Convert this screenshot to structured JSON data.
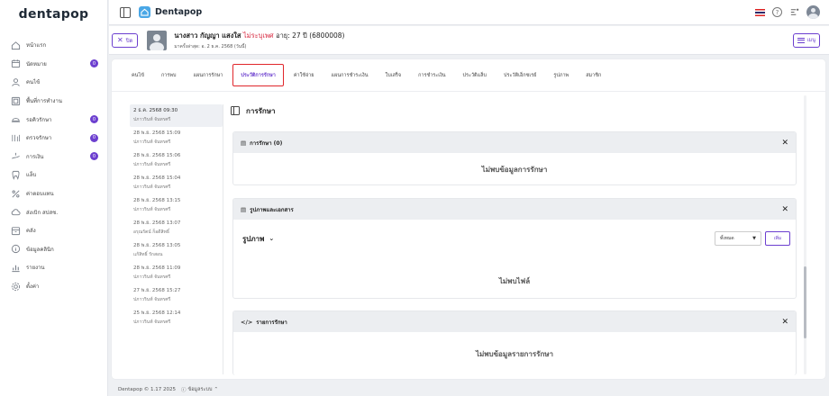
{
  "brand": {
    "logo_text": "dentapop"
  },
  "sidebar": {
    "items": [
      {
        "label": "หน้าแรก",
        "icon": "home-icon",
        "badge": ""
      },
      {
        "label": "นัดหมาย",
        "icon": "calendar-icon",
        "badge": "0"
      },
      {
        "label": "คนไข้",
        "icon": "user-icon",
        "badge": ""
      },
      {
        "label": "พื้นที่การทำงาน",
        "icon": "workspace-icon",
        "badge": ""
      },
      {
        "label": "รอคิวรักษา",
        "icon": "queue-icon",
        "badge": "0"
      },
      {
        "label": "ตรวจรักษา",
        "icon": "treatment-icon",
        "badge": "0"
      },
      {
        "label": "การเงิน",
        "icon": "finance-icon",
        "badge": "0"
      },
      {
        "label": "แล็บ",
        "icon": "lab-icon",
        "badge": ""
      },
      {
        "label": "ค่าตอบแทน",
        "icon": "percent-icon",
        "badge": ""
      },
      {
        "label": "ส่งเบิก สปสช.",
        "icon": "cloud-icon",
        "badge": ""
      },
      {
        "label": "คลัง",
        "icon": "inventory-icon",
        "badge": ""
      },
      {
        "label": "ข้อมูลคลินิก",
        "icon": "info-icon",
        "badge": ""
      },
      {
        "label": "รายงาน",
        "icon": "report-icon",
        "badge": ""
      },
      {
        "label": "ตั้งค่า",
        "icon": "settings-icon",
        "badge": ""
      }
    ]
  },
  "topbar": {
    "clinic_name": "Dentapop"
  },
  "patient": {
    "close_label": "ปิด",
    "name": "นางสาว กัญญา แสงใส",
    "gender": "ไม่ระบุเพศ",
    "age": "อายุ: 27 ปี",
    "hn": "(6800008)",
    "last_visit": "มาครั้งล่าสุด: อ. 2 ธ.ค. 2568 (วันนี้)",
    "menu_label": "เมนู"
  },
  "tabs": [
    {
      "label": "คนไข้",
      "active": false
    },
    {
      "label": "การพบ",
      "active": false
    },
    {
      "label": "แผนการรักษา",
      "active": false
    },
    {
      "label": "ประวัติการรักษา",
      "active": true
    },
    {
      "label": "ค่าใช้จ่าย",
      "active": false
    },
    {
      "label": "แผนการชำระเงิน",
      "active": false
    },
    {
      "label": "ใบเสร็จ",
      "active": false
    },
    {
      "label": "การชำระเงิน",
      "active": false
    },
    {
      "label": "ประวัติแล็บ",
      "active": false
    },
    {
      "label": "ประวัติเอ็กซเรย์",
      "active": false
    },
    {
      "label": "รูปภาพ",
      "active": false
    },
    {
      "label": "สมาชิก",
      "active": false
    }
  ],
  "dates": [
    {
      "date": "2 ธ.ค. 2568 09:30",
      "user": "ปภาวรินท์ จันทรศรี",
      "active": true
    },
    {
      "date": "28 พ.ย. 2568 15:09",
      "user": "ปภาวรินท์ จันทรศรี",
      "active": false
    },
    {
      "date": "28 พ.ย. 2568 15:06",
      "user": "ปภาวรินท์ จันทรศรี",
      "active": false
    },
    {
      "date": "28 พ.ย. 2568 15:04",
      "user": "ปภาวรินท์ จันทรศรี",
      "active": false
    },
    {
      "date": "28 พ.ย. 2568 13:15",
      "user": "ปภาวรินท์ จันทรศรี",
      "active": false
    },
    {
      "date": "28 พ.ย. 2568 13:07",
      "user": "อรุณรัตน์ ก็อดีสิทธิ์",
      "active": false
    },
    {
      "date": "28 พ.ย. 2568 13:05",
      "user": "แก้สิทธิ์ รักสอน",
      "active": false
    },
    {
      "date": "28 พ.ย. 2568 11:09",
      "user": "ปภาวรินท์ จันทรศรี",
      "active": false
    },
    {
      "date": "27 พ.ย. 2568 15:27",
      "user": "ปภาวรินท์ จันทรศรี",
      "active": false
    },
    {
      "date": "25 พ.ย. 2568 12:14",
      "user": "ปภาวรินท์ จันทรศรี",
      "active": false
    }
  ],
  "content": {
    "title": "การรักษา",
    "treatment_panel": {
      "title": "การรักษา (0)",
      "empty": "ไม่พบข้อมูลการรักษา"
    },
    "images_panel": {
      "title": "รูปภาพและเอกสาร",
      "sub_title": "รูปภาพ",
      "filter_value": "ทั้งหมด",
      "add_label": "เพิ่ม",
      "empty": "ไม่พบไฟล์"
    },
    "items_panel": {
      "title": "รายการรักษา",
      "empty": "ไม่พบข้อมูลรายการรักษา"
    }
  },
  "footer": {
    "copyright": "Dentapop © 1.17 2025",
    "info_label": "ข้อมูลระบบ"
  },
  "colors": {
    "accent": "#6c3fcf",
    "badge": "#6c3fcf",
    "warning_text": "#d7263d",
    "active_tab_outline": "#e0262b"
  }
}
